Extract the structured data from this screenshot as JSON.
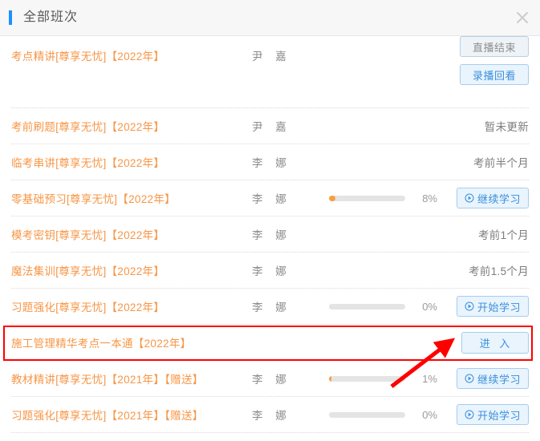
{
  "header": {
    "title": "全部班次",
    "close_icon": "close-icon",
    "accent_color": "#1e90ff"
  },
  "colors": {
    "course_title_orange": "#f79646",
    "button_blue": "#3b8fdc",
    "button_bg": "#e9f4fd",
    "progress_orange": "#f7a043",
    "highlight_red": "#ff0000"
  },
  "rows": [
    {
      "name": "考点精讲[尊享无忧]【2022年】",
      "teacher": "尹 嘉",
      "progress": null,
      "percent": "",
      "status": "",
      "buttons": [
        {
          "label": "直播结束",
          "state": "disabled",
          "icon": null
        },
        {
          "label": "录播回看",
          "state": "enabled",
          "icon": null
        }
      ]
    },
    {
      "name": "考前刷题[尊享无忧]【2022年】",
      "teacher": "尹 嘉",
      "progress": null,
      "percent": "",
      "status": "暂未更新",
      "buttons": []
    },
    {
      "name": "临考串讲[尊享无忧]【2022年】",
      "teacher": "李 娜",
      "progress": null,
      "percent": "",
      "status": "考前半个月",
      "buttons": []
    },
    {
      "name": "零基础预习[尊享无忧]【2022年】",
      "teacher": "李 娜",
      "progress": 8,
      "percent": "8%",
      "status": "",
      "buttons": [
        {
          "label": "继续学习",
          "state": "enabled",
          "icon": "play-circle-icon"
        }
      ]
    },
    {
      "name": "模考密钥[尊享无忧]【2022年】",
      "teacher": "李 娜",
      "progress": null,
      "percent": "",
      "status": "考前1个月",
      "buttons": []
    },
    {
      "name": "魔法集训[尊享无忧]【2022年】",
      "teacher": "李 娜",
      "progress": null,
      "percent": "",
      "status": "考前1.5个月",
      "buttons": []
    },
    {
      "name": "习题强化[尊享无忧]【2022年】",
      "teacher": "李 娜",
      "progress": 0,
      "percent": "0%",
      "status": "",
      "buttons": [
        {
          "label": "开始学习",
          "state": "enabled",
          "icon": "play-circle-icon"
        }
      ]
    },
    {
      "name": "施工管理精华考点一本通【2022年】",
      "teacher": "",
      "progress": null,
      "percent": "",
      "status": "",
      "highlighted": true,
      "buttons": [
        {
          "label": "进 入",
          "state": "enabled",
          "icon": null
        }
      ]
    },
    {
      "name": "教材精讲[尊享无忧]【2021年】【赠送】",
      "teacher": "李 娜",
      "progress": 1,
      "percent": "1%",
      "status": "",
      "buttons": [
        {
          "label": "继续学习",
          "state": "enabled",
          "icon": "play-circle-icon"
        }
      ]
    },
    {
      "name": "习题强化[尊享无忧]【2021年】【赠送】",
      "teacher": "李 娜",
      "progress": 0,
      "percent": "0%",
      "status": "",
      "buttons": [
        {
          "label": "开始学习",
          "state": "enabled",
          "icon": "play-circle-icon"
        }
      ]
    }
  ]
}
